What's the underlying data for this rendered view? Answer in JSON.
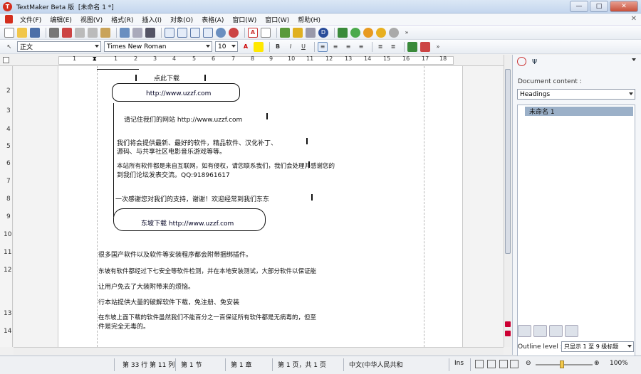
{
  "app": {
    "title": "TextMaker Beta 版",
    "doc": "[未命名 1 *]",
    "logo": "T"
  },
  "window": {
    "minimize": "—",
    "maximize": "□",
    "close": "✕"
  },
  "menu": [
    "文件(F)",
    "编辑(E)",
    "视图(V)",
    "格式(R)",
    "插入(I)",
    "对象(O)",
    "表格(A)",
    "窗口(W)",
    "窗口(W)",
    "帮助(H)"
  ],
  "format": {
    "style": "正文",
    "font": "Times New Roman",
    "size": "10"
  },
  "ruler": {
    "h": [
      "1",
      "1",
      "2",
      "3",
      "4",
      "5",
      "6",
      "7",
      "8",
      "9",
      "10",
      "11",
      "12",
      "13",
      "14",
      "15",
      "16",
      "17",
      "18"
    ],
    "v": [
      "2",
      "3",
      "4",
      "5",
      "6",
      "7",
      "8",
      "9",
      "10",
      "11",
      "12",
      "13",
      "14"
    ]
  },
  "doc": {
    "box_download": "点此下载",
    "url1": "http://www.uzzf.com",
    "remember": "请记住我们的网站 http://www.uzzf.com",
    "p1a": "我们将会提供最新、最好的软件，精品软件、汉化补丁、",
    "p1b": "源码、与共享社区电影音乐游戏等等。",
    "p2a": "本站所有软件都是来自互联网，如有侵权，请您联系我们，我们会处理并感谢您的",
    "p2b": "到我们论坛发表交流。QQ:918961617",
    "thanks": "一次感谢您对我们的支持，谢谢！欢迎经常到我们东东",
    "download2": "东坡下载 http://www.uzzf.com",
    "l1": "很多国产软件以及软件等安装程序都会附带捆绑插件。",
    "l2": "东坡有软件都经过下七安全等软件检测，并在本地安装测试，大部分软件以保证能",
    "l3": "让用户免去了大装附带来的烦恼。",
    "l4": "行本站提供大量的破解软件下载，免注册、免安装",
    "l5a": "在东坡上面下载的软件虽然我们不能百分之一百保证所有软件都是无病毒的，但至",
    "l5b": "件是完全无毒的。"
  },
  "sidebar": {
    "doc_content": "Document content :",
    "headings": "Headings",
    "item": "未命名 1",
    "outline_label": "Outline level :",
    "outline_value": "只显示 1 至 9 级标题"
  },
  "status": {
    "pos": "第 33 行 第 11 列",
    "sec": "第 1 节",
    "chap": "第 1 章",
    "page": "第 1 页，共 1 页",
    "lang": "中文(中华人民共和",
    "mode": "Ins",
    "zoom": "100%"
  }
}
